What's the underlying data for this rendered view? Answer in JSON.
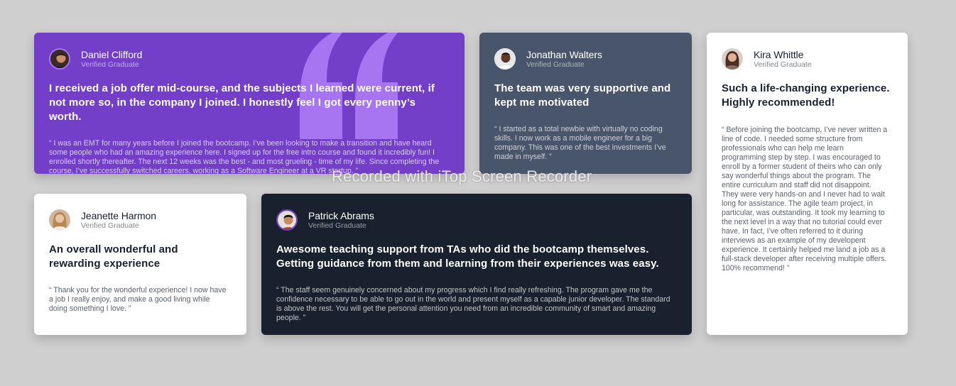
{
  "colors": {
    "background": "#cfcfcf",
    "moderate_violet": "#733fc8",
    "grayish_blue": "#48556a",
    "very_dark_blackish_blue": "#19212e",
    "white": "#ffffff",
    "quote_mark": "#a775f1"
  },
  "watermark": "Recorded with iTop Screen Recorder",
  "testimonials": {
    "daniel": {
      "name": "Daniel Clifford",
      "role": "Verified Graduate",
      "headline": "I received a job offer mid-course, and the subjects I learned were current, if not more so, in the company I joined. I honestly feel I got every penny’s worth.",
      "quote": "“ I was an EMT for many years before I joined the bootcamp. I’ve been looking to make a transition and have heard some people who had an amazing experience here. I signed up for the free intro course and found it incredibly fun! I enrolled shortly thereafter. The next 12 weeks was the best - and most grueling - time of my life. Since completing the course, I’ve successfully switched careers, working as a Software Engineer at a VR startup. ”",
      "avatar_icon": "man-portrait-icon"
    },
    "jonathan": {
      "name": "Jonathan Walters",
      "role": "Verified Graduate",
      "headline": "The team was very supportive and kept me motivated",
      "quote": "“ I started as a total newbie with virtually no coding skills. I now work as a mobile engineer for a big company. This was one of the best investments I’ve made in myself. ”",
      "avatar_icon": "man-portrait-icon"
    },
    "kira": {
      "name": "Kira Whittle",
      "role": "Verified Graduate",
      "headline": "Such a life-changing experience. Highly recommended!",
      "quote": "“ Before joining the bootcamp, I’ve never written a line of code. I needed some structure from professionals who can help me learn programming step by step. I was encouraged to enroll by a former student of theirs who can only say wonderful things about the program. The entire curriculum and staff did not disappoint. They were very hands-on and I never had to wait long for assistance. The agile team project, in particular, was outstanding. It took my learning to the next level in a way that no tutorial could ever have. In fact, I’ve often referred to it during interviews as an example of my developent experience. It certainly helped me land a job as a full-stack developer after receiving multiple offers. 100% recommend! ”",
      "avatar_icon": "woman-portrait-icon"
    },
    "jeanette": {
      "name": "Jeanette Harmon",
      "role": "Verified Graduate",
      "headline": "An overall wonderful and rewarding experience",
      "quote": "“ Thank you for the wonderful experience! I now have a job I really enjoy, and make a good living while doing something I love. ”",
      "avatar_icon": "woman-portrait-icon"
    },
    "patrick": {
      "name": "Patrick Abrams",
      "role": "Verified Graduate",
      "headline": "Awesome teaching support from TAs who did the bootcamp themselves. Getting guidance from them and learning from their experiences was easy.",
      "quote": "“ The staff seem genuinely concerned about my progress which I find really refreshing. The program gave me the confidence necessary to be able to go out in the world and present myself as a capable junior developer. The standard is above the rest. You will get the personal attention you need from an incredible community of smart and amazing people. ”",
      "avatar_icon": "man-portrait-icon"
    }
  }
}
